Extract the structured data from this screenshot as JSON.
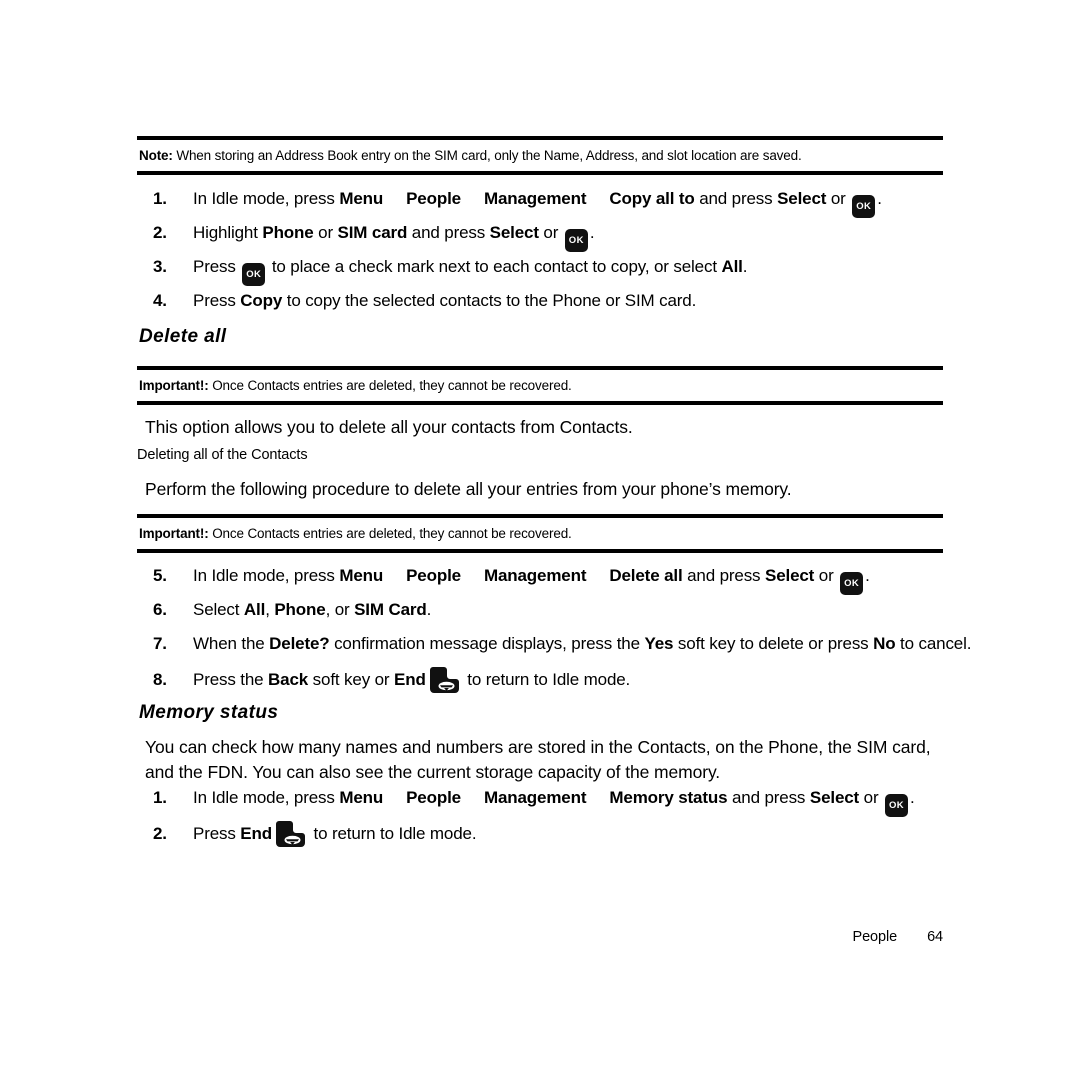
{
  "document": {
    "note_callout": {
      "label": "Note:",
      "text": " When storing an Address Book entry on the SIM card, only the Name, Address, and slot location are saved."
    },
    "copy_all_steps": [
      {
        "num": "1.",
        "pre": "In Idle mode, press ",
        "menu": [
          "Menu",
          "People",
          "Management",
          "Copy all to"
        ],
        "mid": " and press ",
        "select": "Select",
        "or": " or ",
        "key": "OK",
        "post": "."
      },
      {
        "num": "2.",
        "pre": "Highlight ",
        "b1": "Phone",
        "mid1": " or ",
        "b2": "SIM card",
        "mid2": " and press ",
        "select": "Select",
        "or": " or ",
        "key": "OK",
        "post": "."
      },
      {
        "num": "3.",
        "pre": "Press ",
        "key": "OK",
        "mid": " to place a check mark next to each contact to copy, or select ",
        "b1": "All",
        "post": "."
      },
      {
        "num": "4.",
        "pre": "Press ",
        "b1": "Copy",
        "post": " to copy the selected contacts to the Phone or SIM card."
      }
    ],
    "delete_all": {
      "heading": "Delete all",
      "important_1": {
        "label": "Important!:",
        "text": " Once Contacts entries are deleted, they cannot be recovered."
      },
      "intro": "This option allows you to delete all your contacts from Contacts.",
      "subcaption": "Deleting all of the Contacts",
      "perform": "Perform the following procedure to delete all your entries from your phone’s memory.",
      "important_2": {
        "label": "Important!:",
        "text": " Once Contacts entries are deleted, they cannot be recovered."
      },
      "steps": [
        {
          "num": "5.",
          "pre": "In Idle mode, press ",
          "menu": [
            "Menu",
            "People",
            "Management",
            "Delete all"
          ],
          "mid": " and press ",
          "select": "Select",
          "or": " or ",
          "key": "OK",
          "post": "."
        },
        {
          "num": "6.",
          "pre": "Select ",
          "b1": "All",
          "mid1": ", ",
          "b2": "Phone",
          "mid2": ", or ",
          "b3": "SIM Card",
          "post": "."
        },
        {
          "num": "7.",
          "pre": "When the ",
          "b1": "Delete?",
          "mid1": " confirmation message displays, press the ",
          "b2": "Yes",
          "mid2": " soft key to delete or press ",
          "b3": "No",
          "post": " to cancel."
        },
        {
          "num": "8.",
          "pre": "Press the ",
          "b1": "Back",
          "mid1": " soft key or ",
          "b2": "End",
          "key": "end-call-key",
          "post": " to return to Idle mode."
        }
      ]
    },
    "memory_status": {
      "heading": "Memory status",
      "intro": "You can check how many names and numbers are stored in the Contacts, on the Phone, the SIM card, and the FDN. You can also see the current storage capacity of the memory.",
      "steps": [
        {
          "num": "1.",
          "pre": "In Idle mode, press ",
          "menu": [
            "Menu",
            "People",
            "Management",
            "Memory status"
          ],
          "mid": " and press ",
          "select": "Select",
          "or": " or ",
          "key": "OK",
          "post": "."
        },
        {
          "num": "2.",
          "pre": "Press ",
          "b1": "End",
          "key": "end-call-key",
          "post": " to return to Idle mode."
        }
      ]
    },
    "footer": {
      "section": "People",
      "page": "64"
    }
  }
}
